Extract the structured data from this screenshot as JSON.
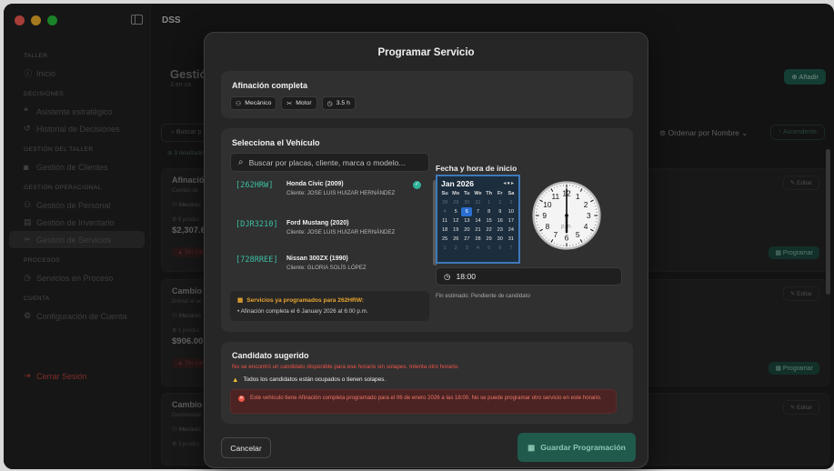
{
  "window": {
    "title": "DSS"
  },
  "sidebar": {
    "sections": [
      {
        "title": "TALLER",
        "items": [
          {
            "label": "Inicio",
            "icon": "info-icon"
          }
        ]
      },
      {
        "title": "DECISIONES",
        "items": [
          {
            "label": "Asistente estratégico",
            "icon": "chat-icon"
          },
          {
            "label": "Historial de Decisiones",
            "icon": "history-icon"
          }
        ]
      },
      {
        "title": "GESTIÓN DEL TALLER",
        "items": [
          {
            "label": "Gestión de Clientes",
            "icon": "client-icon"
          }
        ]
      },
      {
        "title": "GESTIÓN OPERACIONAL",
        "items": [
          {
            "label": "Gestión de Personal",
            "icon": "people-icon"
          },
          {
            "label": "Gestión de Inventario",
            "icon": "box-icon"
          },
          {
            "label": "Gestión de Servicios",
            "icon": "tools-icon",
            "active": true
          }
        ]
      },
      {
        "title": "PROCESOS",
        "items": [
          {
            "label": "Servicios en Proceso",
            "icon": "clock-icon"
          }
        ]
      },
      {
        "title": "CUENTA",
        "items": [
          {
            "label": "Configuración de Cuenta",
            "icon": "gear-icon"
          }
        ]
      }
    ],
    "logout": "Cerrar Sesión"
  },
  "background": {
    "title": "Gestión",
    "subtitle": "3 en ca",
    "add_label": "Añadir",
    "search_placeholder": "Buscar p",
    "results": "3 resultado",
    "sort_label": "Ordenar por Nombre",
    "asc_label": "Ascendente",
    "cards": [
      {
        "title": "Afinación",
        "sub": "Cambio de",
        "mech": "Mecánic",
        "products": "6 produc",
        "price": "$2,307.65",
        "badge": "Sin can",
        "edit": "Editar",
        "prog": "Programar"
      },
      {
        "title": "Cambio de",
        "sub": "Drenar el ac",
        "mech": "Mecánic",
        "products": "1 produc",
        "price": "$906.00",
        "badge": "Sin can",
        "edit": "Editar",
        "prog": "Programar"
      },
      {
        "title": "Cambio de",
        "sub": "Desmontaje",
        "mech": "Mecánic",
        "products": "2 produc",
        "price": "",
        "badge": "",
        "edit": "Editar",
        "prog": ""
      }
    ]
  },
  "modal": {
    "title": "Programar Servicio",
    "service": {
      "name": "Afinación completa",
      "chips": [
        {
          "icon": "people-icon",
          "label": "Mecánico"
        },
        {
          "icon": "tools-icon",
          "label": "Motor"
        },
        {
          "icon": "clock-icon",
          "label": "3.5 h"
        }
      ]
    },
    "vehicle": {
      "title": "Selecciona el Vehículo",
      "search_placeholder": "Buscar por placas, cliente, marca o modelo...",
      "items": [
        {
          "plate": "[262HRW]",
          "name": "Honda Civic (2009)",
          "client": "Cliente: JOSE LUIS HUIZAR HERNÁNDEZ",
          "selected": true
        },
        {
          "plate": "[DJR3210]",
          "name": "Ford Mustang (2020)",
          "client": "Cliente: JOSE LUIS HUIZAR HERNÁNDEZ",
          "selected": false
        },
        {
          "plate": "[728RREE]",
          "name": "Nissan 300ZX (1990)",
          "client": "Cliente: GLORIA SOLÍS LÓPEZ",
          "selected": false
        }
      ],
      "warning_title": "Servicios ya programados para 262HRW:",
      "warning_line": "• Afinación completa el 6 January 2026 at 6:00 p.m."
    },
    "datetime": {
      "label": "Fecha y hora de inicio",
      "month": "Jan 2026",
      "weekdays": [
        "Su",
        "Mo",
        "Tu",
        "We",
        "Th",
        "Fr",
        "Sa"
      ],
      "days": [
        {
          "d": "28",
          "m": true
        },
        {
          "d": "29",
          "m": true
        },
        {
          "d": "30",
          "m": true
        },
        {
          "d": "31",
          "m": true
        },
        {
          "d": "1",
          "m": true
        },
        {
          "d": "2",
          "m": true
        },
        {
          "d": "3",
          "m": true
        },
        {
          "d": "4",
          "m": true
        },
        {
          "d": "5",
          "m": false
        },
        {
          "d": "6",
          "s": true
        },
        {
          "d": "7"
        },
        {
          "d": "8"
        },
        {
          "d": "9"
        },
        {
          "d": "10"
        },
        {
          "d": "11"
        },
        {
          "d": "12"
        },
        {
          "d": "13"
        },
        {
          "d": "14"
        },
        {
          "d": "15"
        },
        {
          "d": "16"
        },
        {
          "d": "17"
        },
        {
          "d": "18"
        },
        {
          "d": "19"
        },
        {
          "d": "20"
        },
        {
          "d": "21"
        },
        {
          "d": "22"
        },
        {
          "d": "23"
        },
        {
          "d": "24"
        },
        {
          "d": "25"
        },
        {
          "d": "26"
        },
        {
          "d": "27"
        },
        {
          "d": "28"
        },
        {
          "d": "29"
        },
        {
          "d": "30"
        },
        {
          "d": "31"
        },
        {
          "d": "1",
          "m": true
        },
        {
          "d": "2",
          "m": true
        },
        {
          "d": "3",
          "m": true
        },
        {
          "d": "4",
          "m": true
        },
        {
          "d": "5",
          "m": true
        },
        {
          "d": "6",
          "m": true
        },
        {
          "d": "7",
          "m": true
        }
      ],
      "clock_numbers": [
        "12",
        "1",
        "2",
        "3",
        "4",
        "5",
        "6",
        "7",
        "8",
        "9",
        "10",
        "11"
      ],
      "clock_ampm": "p.m.",
      "clock_hour": 6,
      "clock_minute": 0,
      "time_value": "18:00",
      "estimated_end": "Fin estimado: Pendiente de candidato"
    },
    "candidate": {
      "title": "Candidato sugerido",
      "error": "No se encontró un candidato disponible para ese horario sin solapes. Intenta otro horario.",
      "warning": "Todos los candidatos están ocupados o tienen solapes.",
      "conflict": "Este vehículo tiene Afinación completa programado para el 06 de enero 2026 a las 18:00. No se puede programar otro servicio en este horario."
    },
    "cancel_label": "Cancelar",
    "save_label": "Guardar Programación"
  },
  "colors": {
    "accent": "#2fb39a",
    "danger": "#ef5548",
    "warning": "#e8a431",
    "selected_day": "#2a6fd0"
  }
}
